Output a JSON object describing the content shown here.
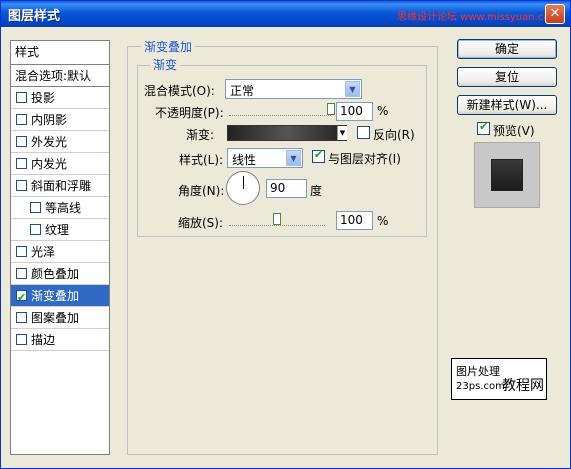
{
  "window": {
    "title": "图层样式",
    "watermark": "思缘设计论坛 www.missyuan.com",
    "close_glyph": "✕"
  },
  "style_list": {
    "header": "样式",
    "blend_options": "混合选项:默认",
    "items": [
      {
        "label": "投影",
        "checked": false,
        "indent": false
      },
      {
        "label": "内阴影",
        "checked": false,
        "indent": false
      },
      {
        "label": "外发光",
        "checked": false,
        "indent": false
      },
      {
        "label": "内发光",
        "checked": false,
        "indent": false
      },
      {
        "label": "斜面和浮雕",
        "checked": false,
        "indent": false
      },
      {
        "label": "等高线",
        "checked": false,
        "indent": true
      },
      {
        "label": "纹理",
        "checked": false,
        "indent": true
      },
      {
        "label": "光泽",
        "checked": false,
        "indent": false
      },
      {
        "label": "颜色叠加",
        "checked": false,
        "indent": false
      },
      {
        "label": "渐变叠加",
        "checked": true,
        "indent": false,
        "selected": true
      },
      {
        "label": "图案叠加",
        "checked": false,
        "indent": false
      },
      {
        "label": "描边",
        "checked": false,
        "indent": false
      }
    ]
  },
  "gradient_overlay": {
    "group_title": "渐变叠加",
    "sub_title": "渐变",
    "blend_mode_label": "混合模式(O):",
    "blend_mode_value": "正常",
    "opacity_label": "不透明度(P):",
    "opacity_value": "100",
    "opacity_unit": "%",
    "opacity_level": 1.0,
    "gradient_label": "渐变:",
    "reverse_label": "反向(R)",
    "reverse_checked": false,
    "style_label": "样式(L):",
    "style_value": "线性",
    "align_label": "与图层对齐(I)",
    "align_checked": true,
    "angle_label": "角度(N):",
    "angle_value": "90",
    "angle_unit": "度",
    "scale_label": "缩放(S):",
    "scale_value": "100",
    "scale_unit": "%",
    "scale_level": 0.5
  },
  "buttons": {
    "ok": "确定",
    "reset": "复位",
    "new_style": "新建样式(W)...",
    "preview_label": "预览(V)",
    "preview_checked": true
  },
  "logo": {
    "line1": "图片处理",
    "line2": "23ps.com",
    "big": "教程网"
  },
  "colors": {
    "title_bar": "#0757d6",
    "selection": "#316ac5",
    "group_title": "#1d56d8",
    "check": "#21a121"
  }
}
